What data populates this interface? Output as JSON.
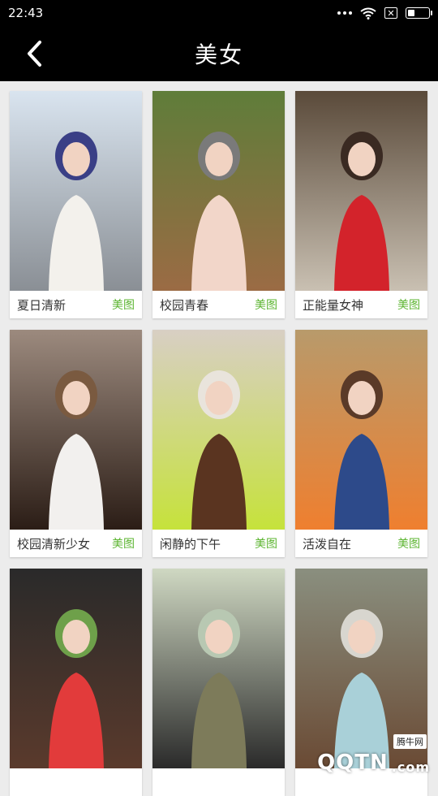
{
  "status_bar": {
    "time": "22:43",
    "close_glyph": "✕"
  },
  "app_bar": {
    "title": "美女",
    "back_icon": "chevron-left-icon"
  },
  "accent_color": "#5cb531",
  "cards": [
    {
      "title": "夏日清新",
      "tag": "美图",
      "palette": [
        "#d9e4ef",
        "#8a8f95",
        "#f3f1ec",
        "#3a3f86"
      ]
    },
    {
      "title": "校园青春",
      "tag": "美图",
      "palette": [
        "#5f7d3a",
        "#9b6b44",
        "#f2d6c9",
        "#7a7a7a"
      ]
    },
    {
      "title": "正能量女神",
      "tag": "美图",
      "palette": [
        "#5a4a3a",
        "#c9c0b2",
        "#d3232b",
        "#3a2a22"
      ]
    },
    {
      "title": "校园清新少女",
      "tag": "美图",
      "palette": [
        "#9c8a7e",
        "#2b1d16",
        "#f2f0ee",
        "#7a5a40"
      ]
    },
    {
      "title": "闲静的下午",
      "tag": "美图",
      "palette": [
        "#d8cfc4",
        "#c6e23b",
        "#5a3420",
        "#e9e4dc"
      ]
    },
    {
      "title": "活泼自在",
      "tag": "美图",
      "palette": [
        "#b89a6b",
        "#ef7f2f",
        "#2d4a8a",
        "#5a3a28"
      ]
    },
    {
      "title": "",
      "tag": "",
      "palette": [
        "#2a2a2a",
        "#5a3a2c",
        "#e23b3b",
        "#6ea04a"
      ]
    },
    {
      "title": "",
      "tag": "",
      "palette": [
        "#cfd8c2",
        "#2a2a2a",
        "#7d7b5a",
        "#b8c8b2"
      ]
    },
    {
      "title": "",
      "tag": "",
      "palette": [
        "#8a8f7f",
        "#6a4a34",
        "#a9d0d8",
        "#d8d6cf"
      ]
    }
  ],
  "watermark": {
    "logo": "QQTN",
    "suffix": ".com",
    "badge": "腾牛网"
  }
}
